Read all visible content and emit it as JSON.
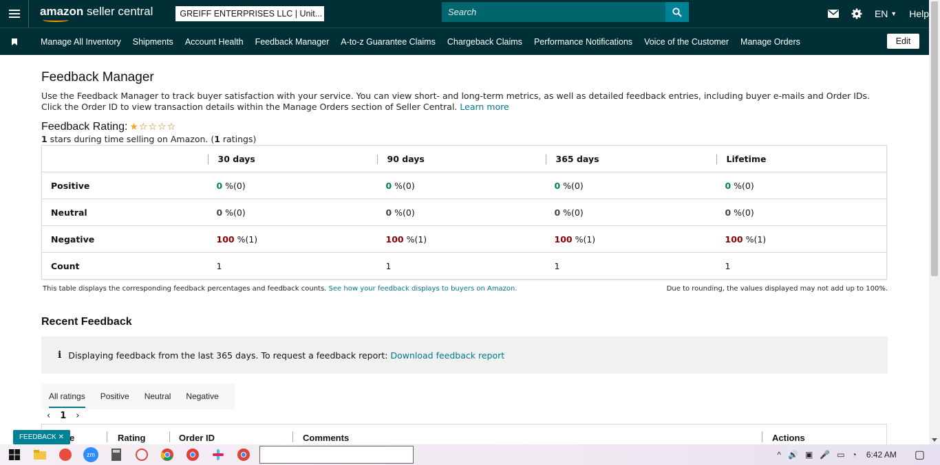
{
  "header": {
    "logo_brand": "amazon",
    "logo_product": " seller central",
    "account": "GREIFF ENTERPRISES LLC | Unit...",
    "search_placeholder": "Search",
    "lang": "EN",
    "help": "Help"
  },
  "nav": {
    "items": [
      "Manage All Inventory",
      "Shipments",
      "Account Health",
      "Feedback Manager",
      "A-to-z Guarantee Claims",
      "Chargeback Claims",
      "Performance Notifications",
      "Voice of the Customer",
      "Manage Orders"
    ],
    "edit": "Edit"
  },
  "page": {
    "title": "Feedback Manager",
    "intro": "Use the Feedback Manager to track buyer satisfaction with your service. You can view short- and long-term metrics, as well as detailed feedback entries, including buyer e-mails and Order IDs. Click the Order ID to view transaction details within the Manage Orders section of Seller Central.",
    "learn_more": "Learn more",
    "rating_title": "Feedback Rating:",
    "rating_stars": 1,
    "rating_stars_max": 5,
    "rating_sub_value": "1",
    "rating_sub_text1": " stars during time selling on Amazon. (",
    "rating_sub_count": "1",
    "rating_sub_text2": " ratings)"
  },
  "table": {
    "headers": [
      "30 days",
      "90 days",
      "365 days",
      "Lifetime"
    ],
    "rows": [
      {
        "label": "Positive",
        "cells": [
          {
            "v": "0",
            "s": " %(0)"
          },
          {
            "v": "0",
            "s": " %(0)"
          },
          {
            "v": "0",
            "s": " %(0)"
          },
          {
            "v": "0",
            "s": " %(0)"
          }
        ]
      },
      {
        "label": "Neutral",
        "cells": [
          {
            "v": "0",
            "s": " %(0)"
          },
          {
            "v": "0",
            "s": " %(0)"
          },
          {
            "v": "0",
            "s": " %(0)"
          },
          {
            "v": "0",
            "s": " %(0)"
          }
        ]
      },
      {
        "label": "Negative",
        "cells": [
          {
            "v": "100",
            "s": " %(1)"
          },
          {
            "v": "100",
            "s": " %(1)"
          },
          {
            "v": "100",
            "s": " %(1)"
          },
          {
            "v": "100",
            "s": " %(1)"
          }
        ]
      },
      {
        "label": "Count",
        "cells": [
          {
            "v": "1",
            "s": ""
          },
          {
            "v": "1",
            "s": ""
          },
          {
            "v": "1",
            "s": ""
          },
          {
            "v": "1",
            "s": ""
          }
        ]
      }
    ],
    "footnote_left": "This table displays the corresponding feedback percentages and feedback counts.",
    "footnote_link": "See how your feedback displays to buyers on Amazon.",
    "footnote_right": "Due to rounding, the values displayed may not add up to 100%."
  },
  "recent": {
    "title": "Recent Feedback",
    "info_text": "Displaying feedback from the last 365 days. To request a feedback report:",
    "info_link": "Download feedback report",
    "tabs": [
      "All ratings",
      "Positive",
      "Neutral",
      "Negative"
    ],
    "page": "1",
    "columns": [
      "e",
      "Rating",
      "Order ID",
      "Comments",
      "Actions"
    ]
  },
  "feedback_tag": "FEEDBACK",
  "taskbar": {
    "clock": "6:42 AM",
    "zm_label": "zm"
  }
}
